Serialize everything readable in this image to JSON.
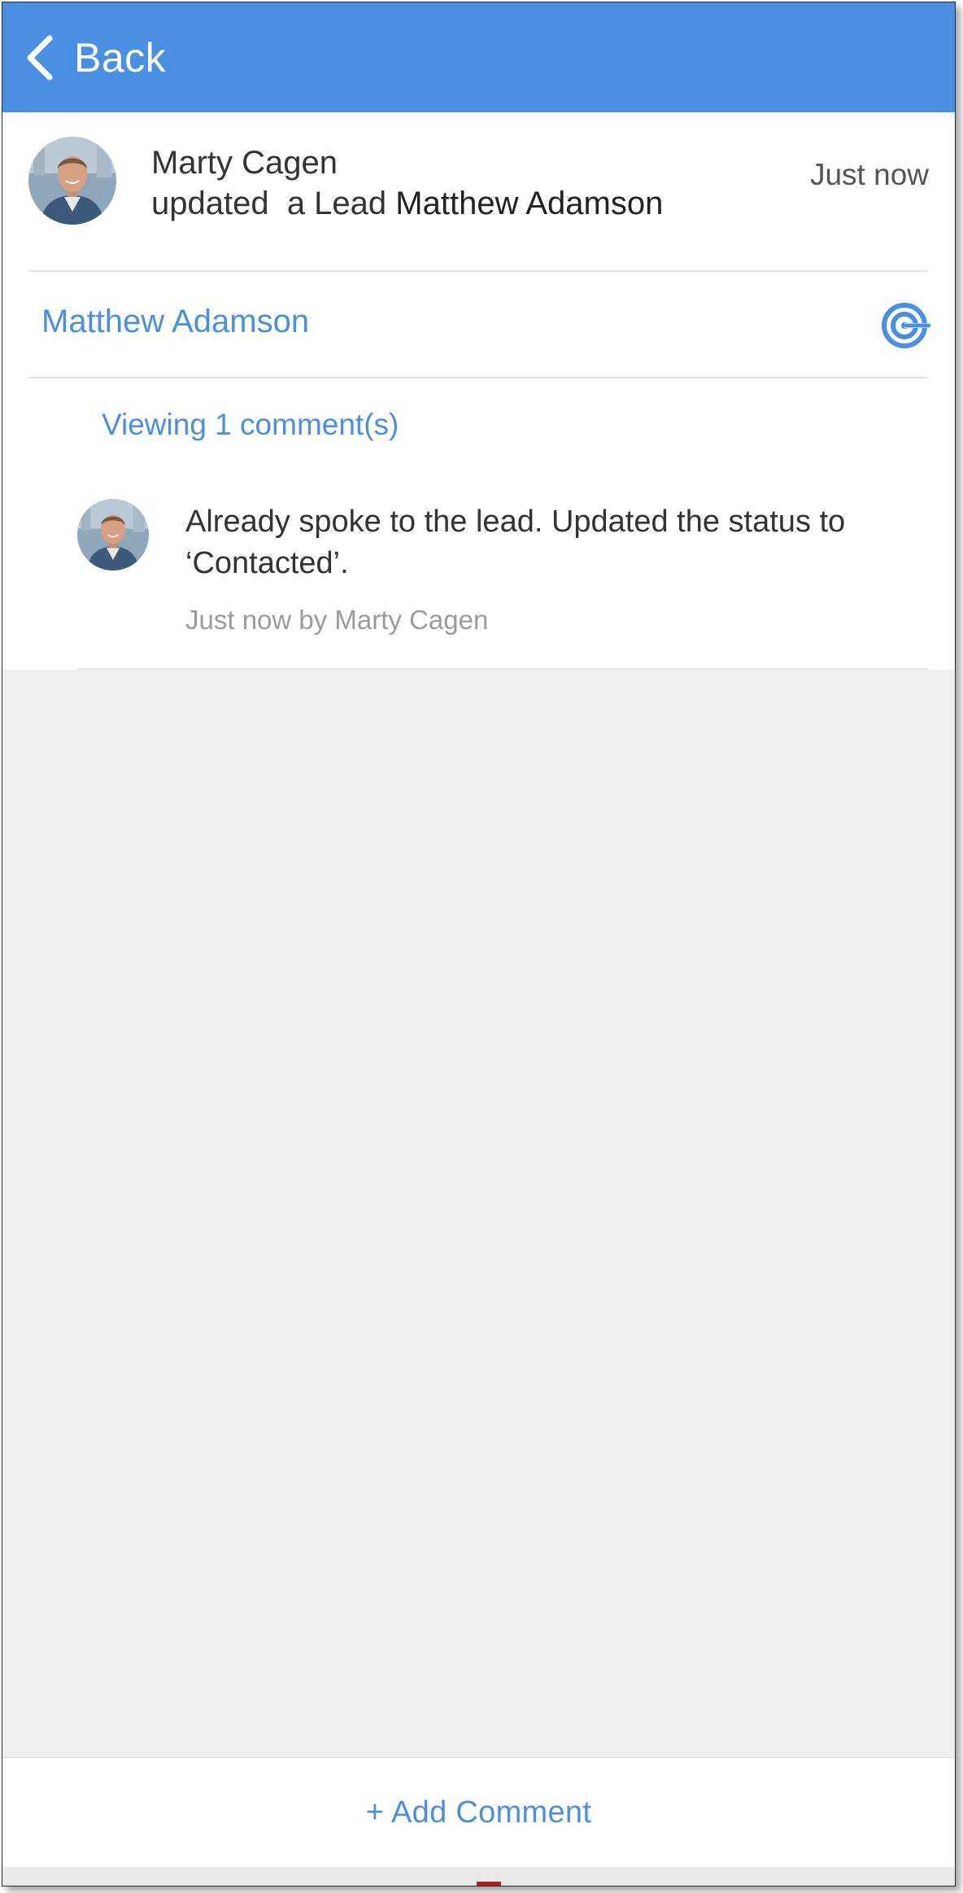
{
  "header": {
    "back_label": "Back",
    "back_icon": "chevron-left-icon"
  },
  "activity": {
    "actor": "Marty Cagen",
    "action": "updated  a Lead ",
    "lead": "Matthew Adamson",
    "time": "Just now"
  },
  "record": {
    "link_label": "Matthew Adamson",
    "icon": "target-icon"
  },
  "comments": {
    "count_label": "Viewing 1 comment(s)",
    "items": [
      {
        "text": "Already spoke to the lead. Updated the status to ‘Contacted’.",
        "meta": "Just now by Marty Cagen"
      }
    ]
  },
  "footer": {
    "add_comment_label": "+ Add Comment"
  },
  "colors": {
    "accent": "#4a90e2",
    "header_background": "#4a90e2",
    "page_background": "#efefef"
  }
}
